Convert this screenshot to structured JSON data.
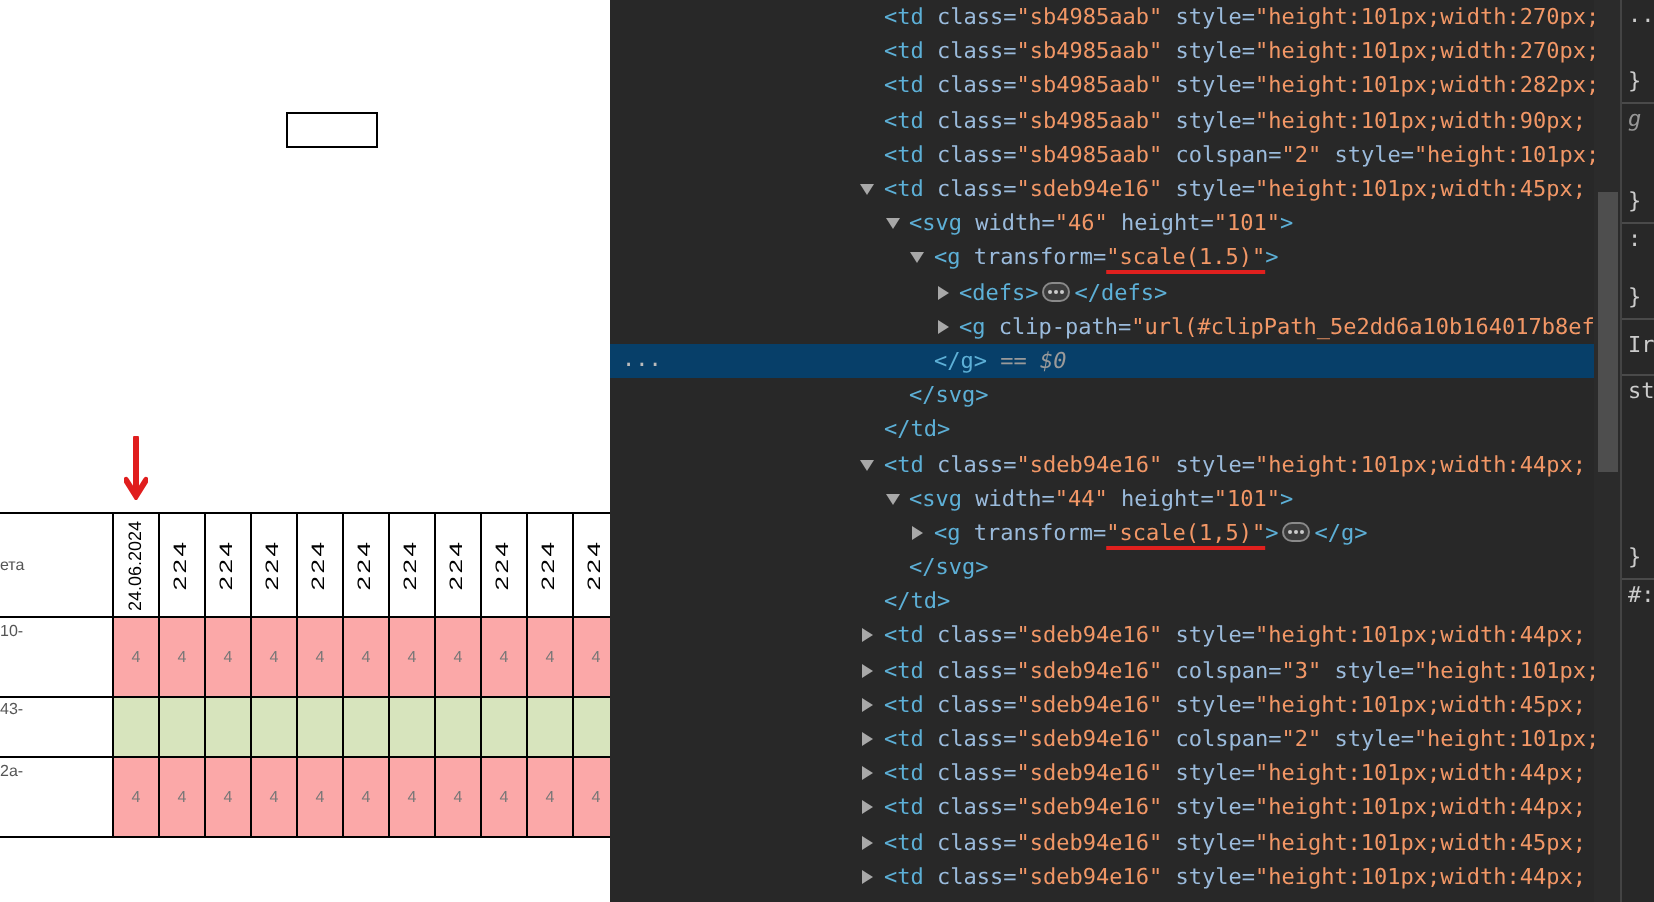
{
  "report": {
    "header_label": "ета",
    "dates": [
      {
        "label": "24.06.2024",
        "kind": "normal"
      },
      {
        "label": "224",
        "kind": "stretched"
      },
      {
        "label": "224",
        "kind": "stretched"
      },
      {
        "label": "224",
        "kind": "stretched"
      },
      {
        "label": "224",
        "kind": "stretched"
      },
      {
        "label": "224",
        "kind": "stretched"
      },
      {
        "label": "224",
        "kind": "stretched"
      },
      {
        "label": "224",
        "kind": "stretched"
      },
      {
        "label": "224",
        "kind": "stretched"
      },
      {
        "label": "224",
        "kind": "stretched"
      },
      {
        "label": "224",
        "kind": "stretched"
      }
    ],
    "rows": [
      {
        "label": "10-",
        "color": "#fba8a8",
        "values": [
          "4",
          "4",
          "4",
          "4",
          "4",
          "4",
          "4",
          "4",
          "4",
          "4",
          "4"
        ]
      },
      {
        "label": "43-",
        "color": "#d7e4bd"
      },
      {
        "label": "2a-",
        "color": "#fba8a8",
        "values": [
          "4",
          "4",
          "4",
          "4",
          "4",
          "4",
          "4",
          "4",
          "4",
          "4",
          "4"
        ]
      }
    ]
  },
  "devtools": {
    "selected_gutter": "...",
    "nodes": [
      {
        "selected": false,
        "open": [
          {
            "kind": "tag",
            "text": "<td"
          },
          {
            "kind": "attr",
            "text": " class="
          },
          {
            "kind": "value",
            "text": "\"sb4985aab\""
          },
          {
            "kind": "attr",
            "text": " style="
          },
          {
            "kind": "value",
            "text": "\"height:101px;width:270px;"
          }
        ]
      },
      {
        "selected": false,
        "open": [
          {
            "kind": "tag",
            "text": "<td"
          },
          {
            "kind": "attr",
            "text": " class="
          },
          {
            "kind": "value",
            "text": "\"sb4985aab\""
          },
          {
            "kind": "attr",
            "text": " style="
          },
          {
            "kind": "value",
            "text": "\"height:101px;width:270px;"
          }
        ]
      },
      {
        "selected": false,
        "open": [
          {
            "kind": "tag",
            "text": "<td"
          },
          {
            "kind": "attr",
            "text": " class="
          },
          {
            "kind": "value",
            "text": "\"sb4985aab\""
          },
          {
            "kind": "attr",
            "text": " style="
          },
          {
            "kind": "value",
            "text": "\"height:101px;width:282px;"
          }
        ]
      },
      {
        "selected": false,
        "open": [
          {
            "kind": "tag",
            "text": "<td"
          },
          {
            "kind": "attr",
            "text": " class="
          },
          {
            "kind": "value",
            "text": "\"sb4985aab\""
          },
          {
            "kind": "attr",
            "text": " style="
          },
          {
            "kind": "value",
            "text": "\"height:101px;width:90px;"
          }
        ]
      },
      {
        "selected": false,
        "open": [
          {
            "kind": "tag",
            "text": "<td"
          },
          {
            "kind": "attr",
            "text": " class="
          },
          {
            "kind": "value",
            "text": "\"sb4985aab\""
          },
          {
            "kind": "attr",
            "text": " colspan="
          },
          {
            "kind": "value",
            "text": "\"2\""
          },
          {
            "kind": "attr",
            "text": " style="
          },
          {
            "kind": "value",
            "text": "\"height:101px;"
          }
        ]
      },
      {
        "selected": false,
        "expanded": true,
        "open": [
          {
            "kind": "tag",
            "text": "<td"
          },
          {
            "kind": "attr",
            "text": " class="
          },
          {
            "kind": "value",
            "text": "\"sdeb94e16\""
          },
          {
            "kind": "attr",
            "text": " style="
          },
          {
            "kind": "value",
            "text": "\"height:101px;width:45px;"
          }
        ],
        "close_selected": false,
        "close": [
          {
            "kind": "tag",
            "text": "</td>"
          }
        ],
        "children": [
          {
            "selected": false,
            "expanded": true,
            "open": [
              {
                "kind": "tag",
                "text": "<svg"
              },
              {
                "kind": "attr",
                "text": " width="
              },
              {
                "kind": "value",
                "text": "\"46\""
              },
              {
                "kind": "attr",
                "text": " height="
              },
              {
                "kind": "value",
                "text": "\"101\""
              },
              {
                "kind": "tag",
                "text": ">"
              }
            ],
            "close_selected": false,
            "close": [
              {
                "kind": "tag",
                "text": "</svg>"
              }
            ],
            "children": [
              {
                "selected": false,
                "expanded": true,
                "open": [
                  {
                    "kind": "tag",
                    "text": "<g"
                  },
                  {
                    "kind": "attr",
                    "text": " transform="
                  },
                  {
                    "kind": "value",
                    "text": "\"scale(1.5)\"",
                    "underlined": true
                  },
                  {
                    "kind": "tag",
                    "text": ">"
                  }
                ],
                "close_selected": true,
                "close": [
                  {
                    "kind": "tag",
                    "text": "</g>"
                  },
                  {
                    "kind": "ref",
                    "text": " == $0"
                  }
                ],
                "children": [
                  {
                    "selected": false,
                    "expanded": false,
                    "open": [
                      {
                        "kind": "tag",
                        "text": "<defs>"
                      },
                      {
                        "kind": "ellipsis"
                      },
                      {
                        "kind": "tag",
                        "text": "</defs>"
                      }
                    ]
                  },
                  {
                    "selected": false,
                    "expanded": false,
                    "open": [
                      {
                        "kind": "tag",
                        "text": "<g"
                      },
                      {
                        "kind": "attr",
                        "text": " clip-path="
                      },
                      {
                        "kind": "value",
                        "text": "\"url(#clipPath_5e2dd6a10b164017b8ef"
                      }
                    ]
                  }
                ]
              }
            ]
          }
        ]
      },
      {
        "selected": false,
        "expanded": true,
        "open": [
          {
            "kind": "tag",
            "text": "<td"
          },
          {
            "kind": "attr",
            "text": " class="
          },
          {
            "kind": "value",
            "text": "\"sdeb94e16\""
          },
          {
            "kind": "attr",
            "text": " style="
          },
          {
            "kind": "value",
            "text": "\"height:101px;width:44px;"
          }
        ],
        "close_selected": false,
        "close": [
          {
            "kind": "tag",
            "text": "</td>"
          }
        ],
        "children": [
          {
            "selected": false,
            "expanded": true,
            "open": [
              {
                "kind": "tag",
                "text": "<svg"
              },
              {
                "kind": "attr",
                "text": " width="
              },
              {
                "kind": "value",
                "text": "\"44\""
              },
              {
                "kind": "attr",
                "text": " height="
              },
              {
                "kind": "value",
                "text": "\"101\""
              },
              {
                "kind": "tag",
                "text": ">"
              }
            ],
            "close_selected": false,
            "close": [
              {
                "kind": "tag",
                "text": "</svg>"
              }
            ],
            "children": [
              {
                "selected": false,
                "expanded": false,
                "open": [
                  {
                    "kind": "tag",
                    "text": "<g"
                  },
                  {
                    "kind": "attr",
                    "text": " transform="
                  },
                  {
                    "kind": "value",
                    "text": "\"scale(1,5)\"",
                    "underlined": true
                  },
                  {
                    "kind": "tag",
                    "text": ">"
                  },
                  {
                    "kind": "ellipsis"
                  },
                  {
                    "kind": "tag",
                    "text": "</g>"
                  }
                ]
              }
            ]
          }
        ]
      },
      {
        "selected": false,
        "expanded": false,
        "open": [
          {
            "kind": "tag",
            "text": "<td"
          },
          {
            "kind": "attr",
            "text": " class="
          },
          {
            "kind": "value",
            "text": "\"sdeb94e16\""
          },
          {
            "kind": "attr",
            "text": " style="
          },
          {
            "kind": "value",
            "text": "\"height:101px;width:44px;"
          }
        ]
      },
      {
        "selected": false,
        "expanded": false,
        "open": [
          {
            "kind": "tag",
            "text": "<td"
          },
          {
            "kind": "attr",
            "text": " class="
          },
          {
            "kind": "value",
            "text": "\"sdeb94e16\""
          },
          {
            "kind": "attr",
            "text": " colspan="
          },
          {
            "kind": "value",
            "text": "\"3\""
          },
          {
            "kind": "attr",
            "text": " style="
          },
          {
            "kind": "value",
            "text": "\"height:101px;"
          }
        ]
      },
      {
        "selected": false,
        "expanded": false,
        "open": [
          {
            "kind": "tag",
            "text": "<td"
          },
          {
            "kind": "attr",
            "text": " class="
          },
          {
            "kind": "value",
            "text": "\"sdeb94e16\""
          },
          {
            "kind": "attr",
            "text": " style="
          },
          {
            "kind": "value",
            "text": "\"height:101px;width:45px;"
          }
        ]
      },
      {
        "selected": false,
        "expanded": false,
        "open": [
          {
            "kind": "tag",
            "text": "<td"
          },
          {
            "kind": "attr",
            "text": " class="
          },
          {
            "kind": "value",
            "text": "\"sdeb94e16\""
          },
          {
            "kind": "attr",
            "text": " colspan="
          },
          {
            "kind": "value",
            "text": "\"2\""
          },
          {
            "kind": "attr",
            "text": " style="
          },
          {
            "kind": "value",
            "text": "\"height:101px;"
          }
        ]
      },
      {
        "selected": false,
        "expanded": false,
        "open": [
          {
            "kind": "tag",
            "text": "<td"
          },
          {
            "kind": "attr",
            "text": " class="
          },
          {
            "kind": "value",
            "text": "\"sdeb94e16\""
          },
          {
            "kind": "attr",
            "text": " style="
          },
          {
            "kind": "value",
            "text": "\"height:101px;width:44px;"
          }
        ]
      },
      {
        "selected": false,
        "expanded": false,
        "open": [
          {
            "kind": "tag",
            "text": "<td"
          },
          {
            "kind": "attr",
            "text": " class="
          },
          {
            "kind": "value",
            "text": "\"sdeb94e16\""
          },
          {
            "kind": "attr",
            "text": " style="
          },
          {
            "kind": "value",
            "text": "\"height:101px;width:44px;"
          }
        ]
      },
      {
        "selected": false,
        "expanded": false,
        "open": [
          {
            "kind": "tag",
            "text": "<td"
          },
          {
            "kind": "attr",
            "text": " class="
          },
          {
            "kind": "value",
            "text": "\"sdeb94e16\""
          },
          {
            "kind": "attr",
            "text": " style="
          },
          {
            "kind": "value",
            "text": "\"height:101px;width:45px;"
          }
        ]
      },
      {
        "selected": false,
        "expanded": false,
        "open": [
          {
            "kind": "tag",
            "text": "<td"
          },
          {
            "kind": "attr",
            "text": " class="
          },
          {
            "kind": "value",
            "text": "\"sdeb94e16\""
          },
          {
            "kind": "attr",
            "text": " style="
          },
          {
            "kind": "value",
            "text": "\"height:101px;width:44px;"
          }
        ]
      }
    ]
  },
  "styles_pane": {
    "sections": [
      [
        "..",
        "}"
      ],
      [
        "g",
        "}"
      ],
      [
        ":",
        "}"
      ],
      [
        "Ir"
      ],
      [
        "st",
        "}"
      ],
      [
        "#:"
      ]
    ]
  }
}
